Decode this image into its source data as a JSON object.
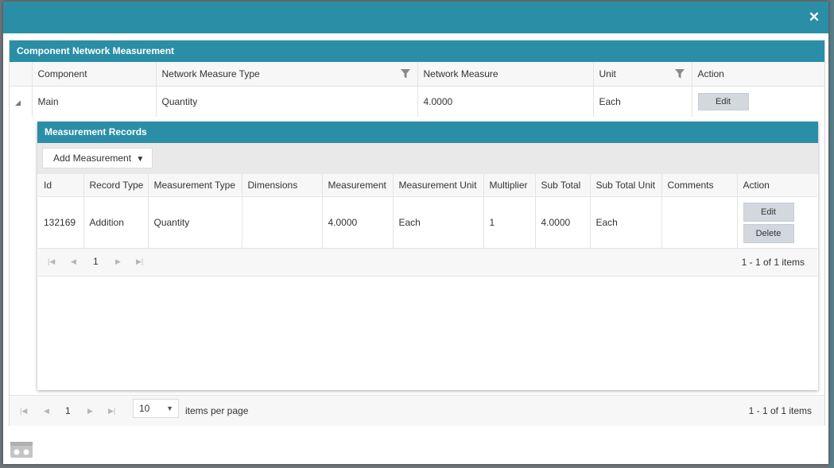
{
  "panel": {
    "title": "Component Network Measurement"
  },
  "outer_grid": {
    "columns": [
      "Component",
      "Network Measure Type",
      "Network Measure",
      "Unit",
      "Action"
    ],
    "row": {
      "component": "Main",
      "measure_type": "Quantity",
      "measure": "4.0000",
      "unit": "Each",
      "action": "Edit"
    }
  },
  "detail": {
    "title": "Measurement Records",
    "add_button": "Add Measurement",
    "columns": [
      "Id",
      "Record Type",
      "Measurement Type",
      "Dimensions",
      "Measurement",
      "Measurement Unit",
      "Multiplier",
      "Sub Total",
      "Sub Total Unit",
      "Comments",
      "Action"
    ],
    "row": {
      "id": "132169",
      "record_type": "Addition",
      "measurement_type": "Quantity",
      "dimensions": "",
      "measurement": "4.0000",
      "measurement_unit": "Each",
      "multiplier": "1",
      "sub_total": "4.0000",
      "sub_total_unit": "Each",
      "comments": "",
      "edit": "Edit",
      "delete": "Delete"
    },
    "pager": {
      "page": "1",
      "info": "1 - 1 of 1 items"
    }
  },
  "outer_pager": {
    "page": "1",
    "page_size": "10",
    "items_per_page": "items per page",
    "info": "1 - 1 of 1 items"
  },
  "icons": {
    "close": "close-icon",
    "filter": "filter-icon",
    "expand": "collapse-arrow-icon",
    "dropdown": "caret-down-icon",
    "first": "first-page-icon",
    "prev": "prev-page-icon",
    "next": "next-page-icon",
    "last": "last-page-icon",
    "bottom": "toolbar-icon"
  },
  "colors": {
    "header": "#2b8ea7",
    "button": "#d3d8df",
    "grid_header": "#f7f7f7",
    "toolbar": "#e9e9e9"
  }
}
